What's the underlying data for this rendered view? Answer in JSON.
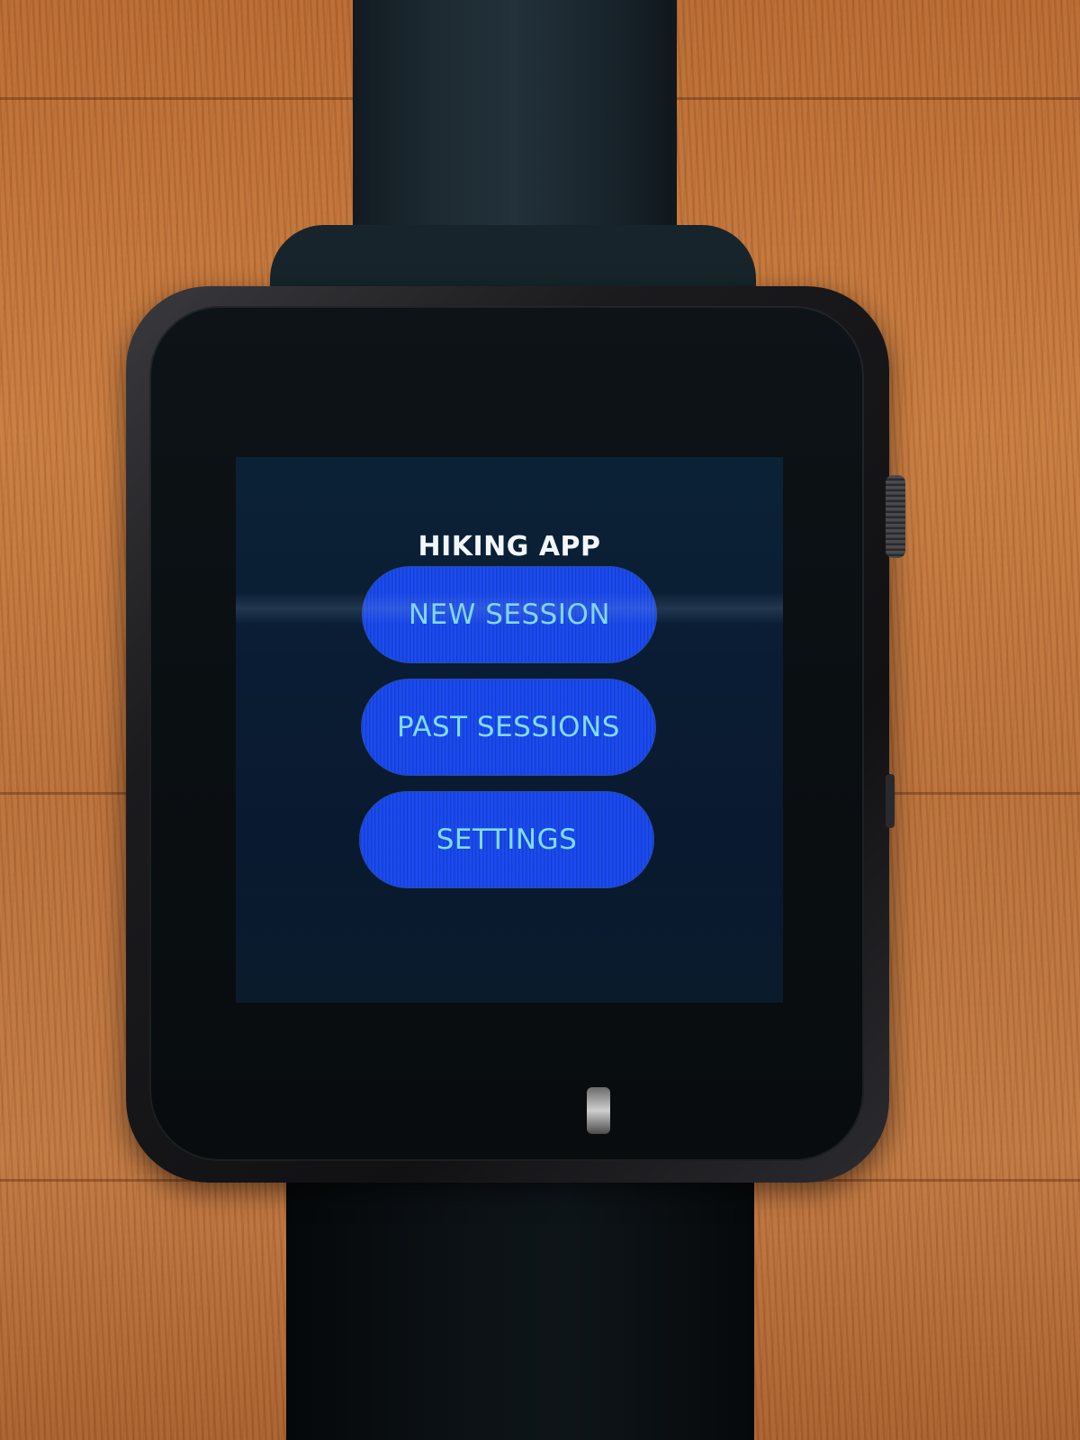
{
  "app": {
    "title": "HIKING APP"
  },
  "menu": {
    "items": [
      {
        "label": "NEW SESSION"
      },
      {
        "label": "PAST SESSIONS"
      },
      {
        "label": "SETTINGS"
      }
    ]
  },
  "colors": {
    "button_fill": "#1b4cf0",
    "button_text": "#7fdcff",
    "title_text": "#f2f6ff",
    "screen_background": "#0a1c33"
  }
}
